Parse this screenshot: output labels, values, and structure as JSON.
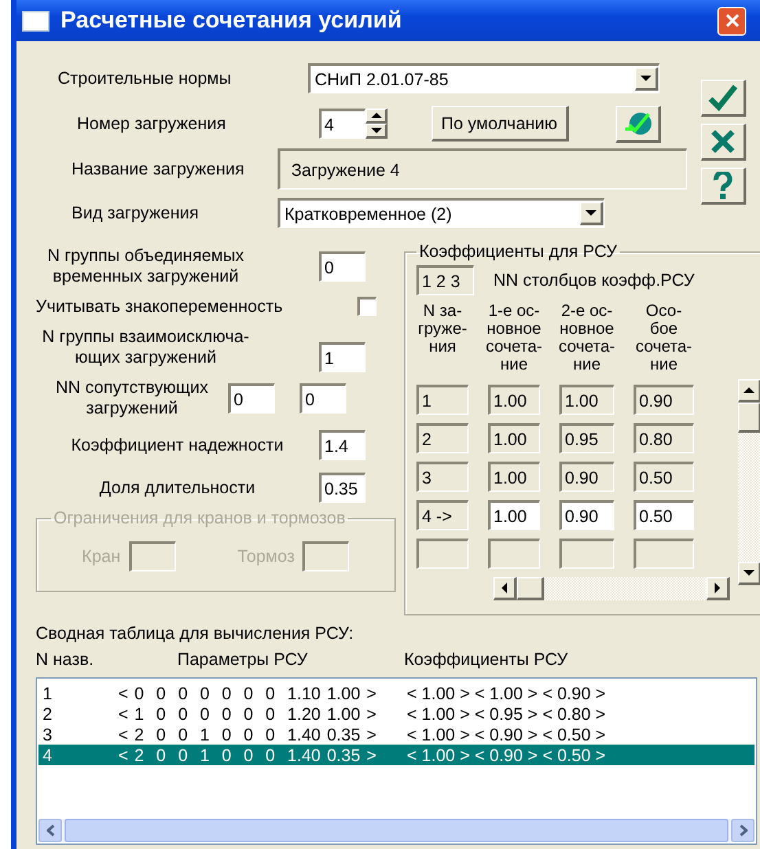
{
  "window": {
    "title": "Расчетные сочетания усилий"
  },
  "standard": {
    "label": "Строительные нормы",
    "value": "СНиП 2.01.07-85"
  },
  "load_number": {
    "label": "Номер загружения",
    "value": "4"
  },
  "default_button": "По умолчанию",
  "load_name": {
    "label": "Название загружения",
    "value": "Загружение  4"
  },
  "load_type": {
    "label": "Вид загружения",
    "value": "Кратковременное (2)"
  },
  "combined_group": {
    "label_lines": [
      "N группы объединяемых",
      "временных загружений"
    ],
    "value": "0"
  },
  "sign_alternation": {
    "label": "Учитывать знакопеременность",
    "checked": false
  },
  "exclusive_group": {
    "label_lines": [
      "N группы взаимоисключа-",
      "ющих загружений"
    ],
    "value": "1"
  },
  "accompanying": {
    "label_lines": [
      "NN сопутствующих",
      "загружений"
    ],
    "values": [
      "0",
      "0"
    ]
  },
  "reliability": {
    "label": "Коэффициент надежности",
    "value": "1.4"
  },
  "duration": {
    "label": "Доля длительности",
    "value": "0.35"
  },
  "crane_group": {
    "title": "Ограничения для кранов и тормозов",
    "disabled": true,
    "fields": [
      "Кран",
      "Тормоз"
    ]
  },
  "coefficients": {
    "title": "Коэффициенты для РСУ",
    "columns_field": "1 2 3",
    "columns_label": "NN столбцов коэфф.РСУ",
    "headers": [
      [
        "N за-",
        "груже-",
        "ния"
      ],
      [
        "1-е ос-",
        "новное",
        "сочета-",
        "ние"
      ],
      [
        "2-е ос-",
        "новное",
        "сочета-",
        "ние"
      ],
      [
        "Осо-",
        "бое",
        "сочета-",
        "ние"
      ]
    ],
    "rows": [
      {
        "n": "1",
        "values": [
          "1.00",
          "1.00",
          "0.90"
        ],
        "selected": false
      },
      {
        "n": "2",
        "values": [
          "1.00",
          "0.95",
          "0.80"
        ],
        "selected": false
      },
      {
        "n": "3",
        "values": [
          "1.00",
          "0.90",
          "0.50"
        ],
        "selected": false
      },
      {
        "n": "4 ->",
        "values": [
          "1.00",
          "0.90",
          "0.50"
        ],
        "selected": true
      }
    ]
  },
  "summary": {
    "title": "Сводная таблица для вычисления РСУ:",
    "headers": [
      "N назв.",
      "Параметры РСУ",
      "Коэффициенты РСУ"
    ],
    "rows": [
      {
        "n": "1",
        "params": "< 0  0  0  0  0  0  0  1.10 1.00 >",
        "coeffs": "< 1.00 > < 1.00 > < 0.90 >",
        "selected": false
      },
      {
        "n": "2",
        "params": "< 1  0  0  0  0  0  0  1.20 1.00 >",
        "coeffs": "< 1.00 > < 0.95 > < 0.80 >",
        "selected": false
      },
      {
        "n": "3",
        "params": "< 2  0  0  1  0  0  0  1.40 0.35 >",
        "coeffs": "< 1.00 > < 0.90 > < 0.50 >",
        "selected": false
      },
      {
        "n": "4",
        "params": "< 2  0  0  1  0  0  0  1.40 0.35 >",
        "coeffs": "< 1.00 > < 0.90 > < 0.50 >",
        "selected": true
      }
    ]
  }
}
